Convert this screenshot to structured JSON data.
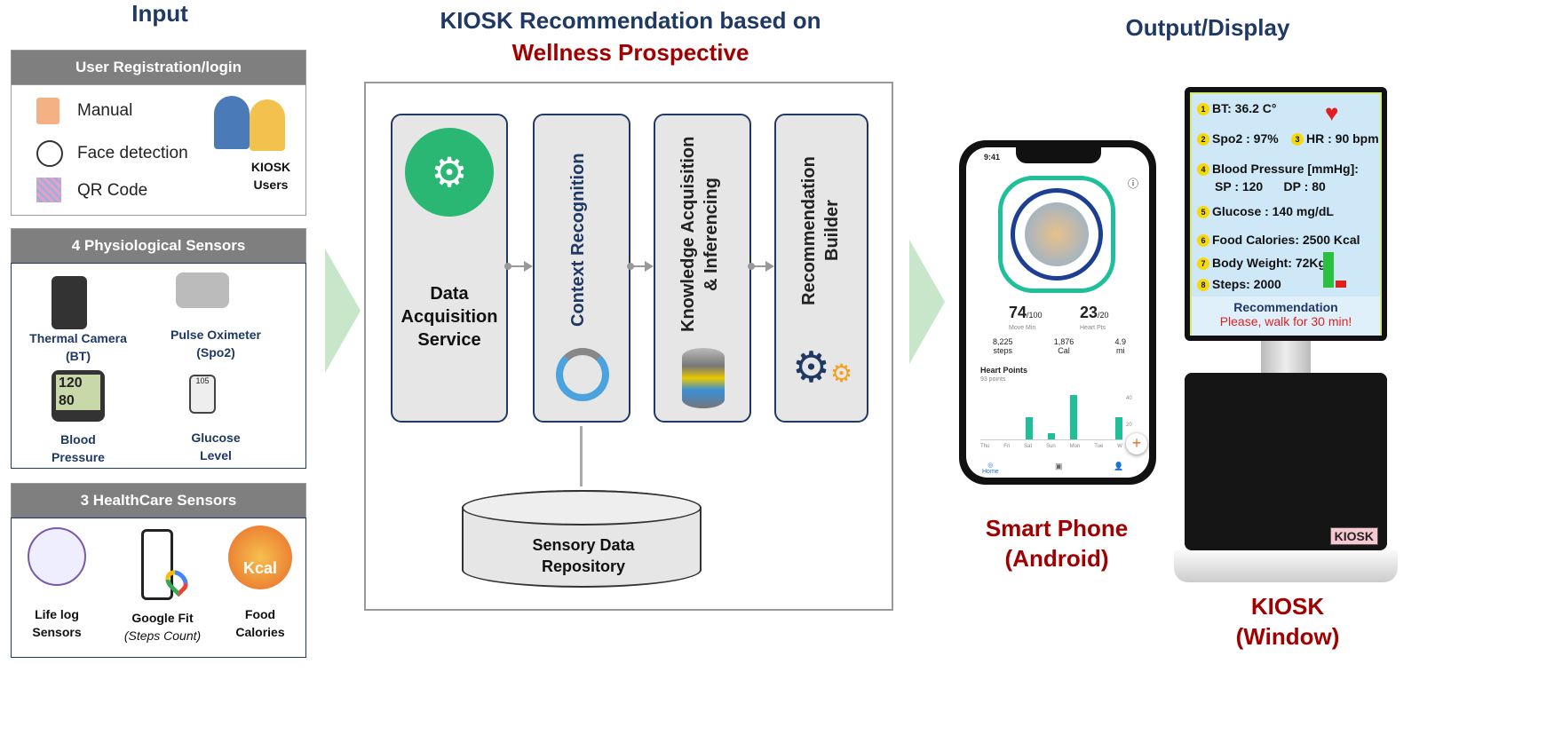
{
  "input": {
    "title": "Input",
    "registration": {
      "title": "User Registration/login",
      "items": [
        "Manual",
        "Face detection",
        "QR Code"
      ],
      "users_label": "KIOSK Users"
    },
    "physio": {
      "title": "4 Physiological Sensors",
      "items": [
        {
          "name": "Thermal Camera",
          "sub": "(BT)"
        },
        {
          "name": "Pulse Oximeter",
          "sub": "(Spo2)"
        },
        {
          "name": "Blood",
          "sub": "Pressure"
        },
        {
          "name": "Glucose",
          "sub": "Level"
        }
      ],
      "bp_display": [
        "120",
        "80"
      ],
      "glucose_display": "105"
    },
    "healthcare": {
      "title": "3 HealthCare Sensors",
      "items": [
        {
          "name": "Life log",
          "sub": "Sensors"
        },
        {
          "name": "Google Fit",
          "sub": "(Steps Count)"
        },
        {
          "name": "Food",
          "sub": "Calories"
        }
      ],
      "kcal": "Kcal"
    }
  },
  "center": {
    "title_line1": "KIOSK Recommendation based on",
    "title_line2": "Wellness Prospective",
    "panels": [
      "Data Acquisition Service",
      "Context Recognition",
      "Knowledge Acquisition & Inferencing",
      "Recommendation Builder"
    ],
    "repository": "Sensory Data Repository"
  },
  "output": {
    "title": "Output/Display",
    "phone": {
      "label1": "Smart Phone",
      "label2": "(Android)",
      "time": "9:41",
      "move_min": "74",
      "move_goal": "/100",
      "move_label": "Move Min",
      "heart_pts": "23",
      "heart_goal": "/20",
      "heart_label": "Heart Pts",
      "stats": [
        {
          "v": "8,225",
          "l": "steps"
        },
        {
          "v": "1,876",
          "l": "Cal"
        },
        {
          "v": "4.9",
          "l": "mi"
        }
      ],
      "chart_title": "Heart Points",
      "chart_sub": "93 points",
      "days": [
        "Thu",
        "Fri",
        "Sat",
        "Sun",
        "Mon",
        "Tue",
        "W"
      ],
      "bars": [
        0,
        0,
        20,
        6,
        40,
        0,
        20
      ],
      "y_ticks": [
        "40",
        "20"
      ],
      "nav_home": "Home"
    },
    "kiosk": {
      "label1": "KIOSK",
      "label2": "(Window)",
      "brand": "KIOSK",
      "rows": [
        {
          "n": "1",
          "t": "BT: 36.2 C°"
        },
        {
          "n": "2",
          "t": "Spo2 : 97%"
        },
        {
          "n": "3",
          "t": "HR : 90 bpm"
        },
        {
          "n": "4",
          "t": "Blood Pressure [mmHg]:"
        },
        {
          "n": "",
          "t": "SP : 120      DP : 80"
        },
        {
          "n": "5",
          "t": "Glucose : 140 mg/dL"
        },
        {
          "n": "6",
          "t": "Food Calories: 2500 Kcal"
        },
        {
          "n": "7",
          "t": "Body Weight: 72Kg"
        },
        {
          "n": "8",
          "t": "Steps: 2000"
        }
      ],
      "rec_title": "Recommendation",
      "rec_text": "Please, walk for 30 min!"
    }
  },
  "colors": {
    "navy": "#1f3864",
    "red": "#a00000",
    "green": "#2ab673",
    "teal": "#1fbf9a"
  }
}
